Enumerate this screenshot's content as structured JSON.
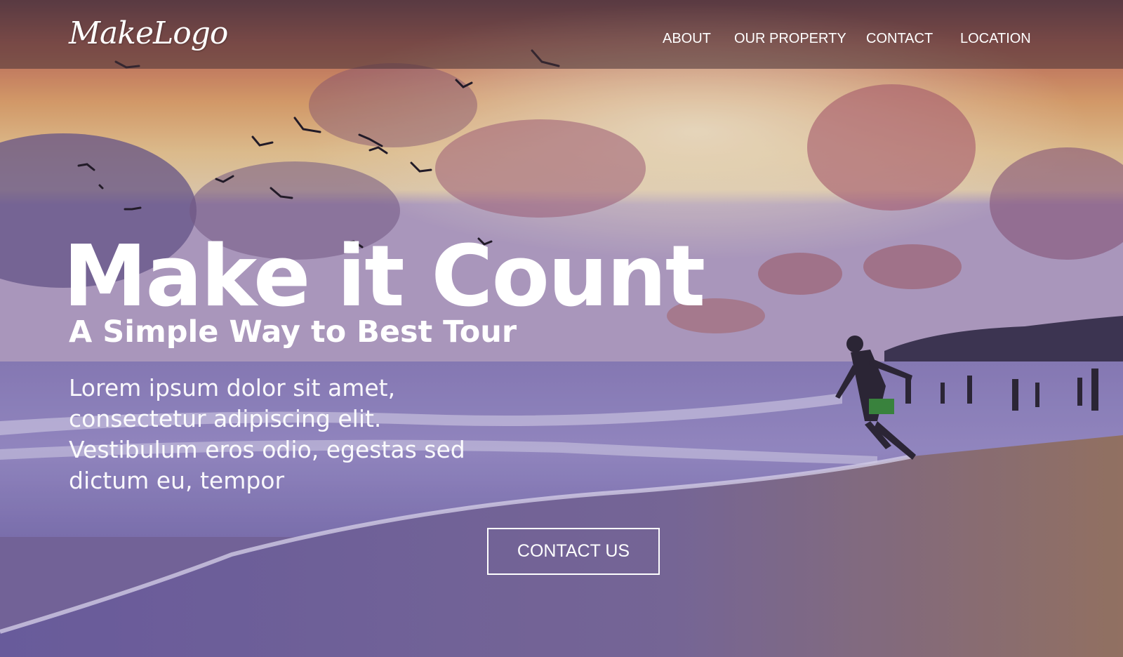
{
  "navbar": {
    "logo_text": "MakeLogo",
    "links": [
      {
        "label": "ABOUT"
      },
      {
        "label": "OUR PROPERTY"
      },
      {
        "label": "CONTACT"
      },
      {
        "label": "LOCATION"
      }
    ]
  },
  "hero": {
    "title": "Make it Count",
    "subtitle": "A Simple Way to Best Tour",
    "body": "Lorem ipsum dolor sit amet, consectetur adipiscing elit. Vestibulum eros odio, egestas sed dictum eu, tempor",
    "cta_label": "CONTACT US",
    "background_image": "beach-sunset-photo"
  },
  "colors": {
    "text": "#ffffff",
    "navbar_overlay": "#46323780"
  }
}
